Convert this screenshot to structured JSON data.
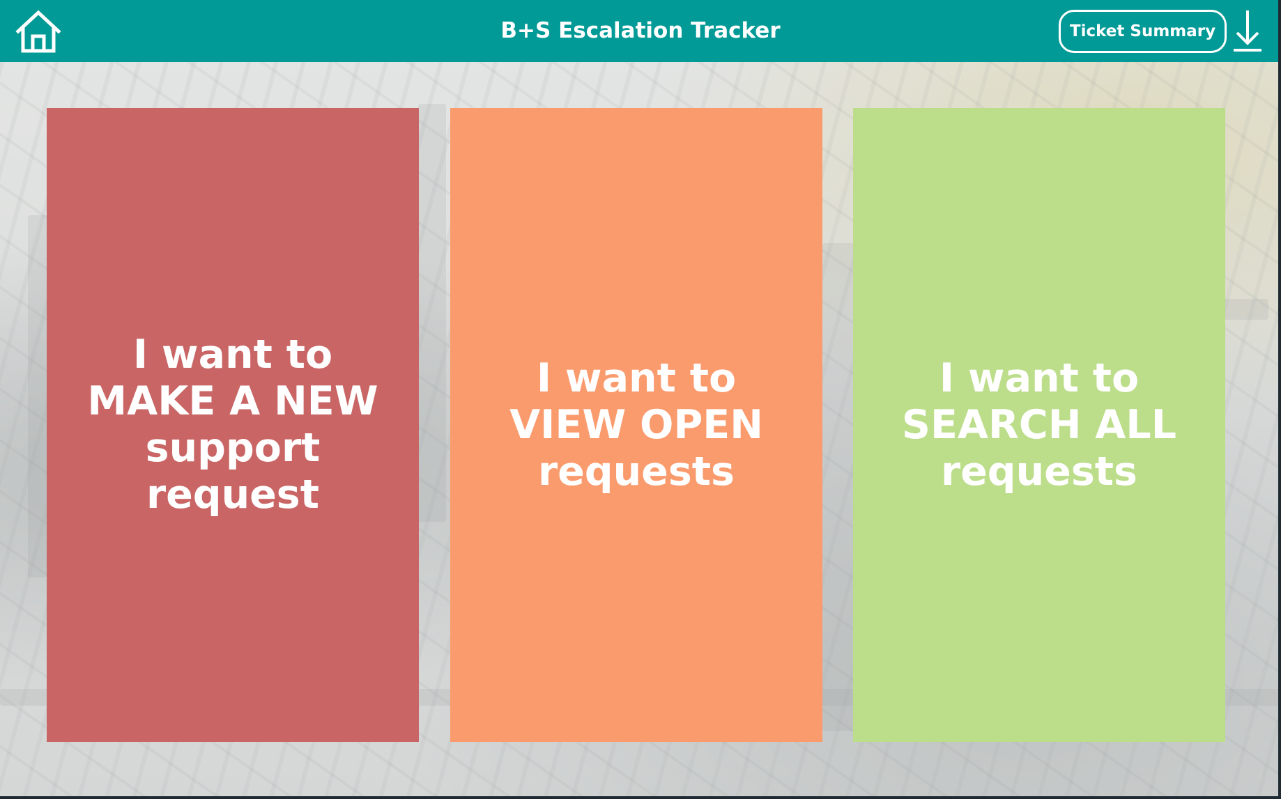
{
  "header": {
    "title": "B+S Escalation Tracker",
    "ticket_summary_label": "Ticket Summary",
    "home_icon": "home-icon",
    "download_icon": "download-icon",
    "background_color": "#029a96"
  },
  "cards": [
    {
      "lines": [
        "I want to",
        "MAKE A NEW",
        "support",
        "request"
      ],
      "color": "#c96565"
    },
    {
      "lines": [
        "I want to",
        "VIEW OPEN",
        "requests"
      ],
      "color": "#fa9b6e"
    },
    {
      "lines": [
        "I want to",
        "SEARCH ALL",
        "requests"
      ],
      "color": "#bcdd8a"
    }
  ]
}
